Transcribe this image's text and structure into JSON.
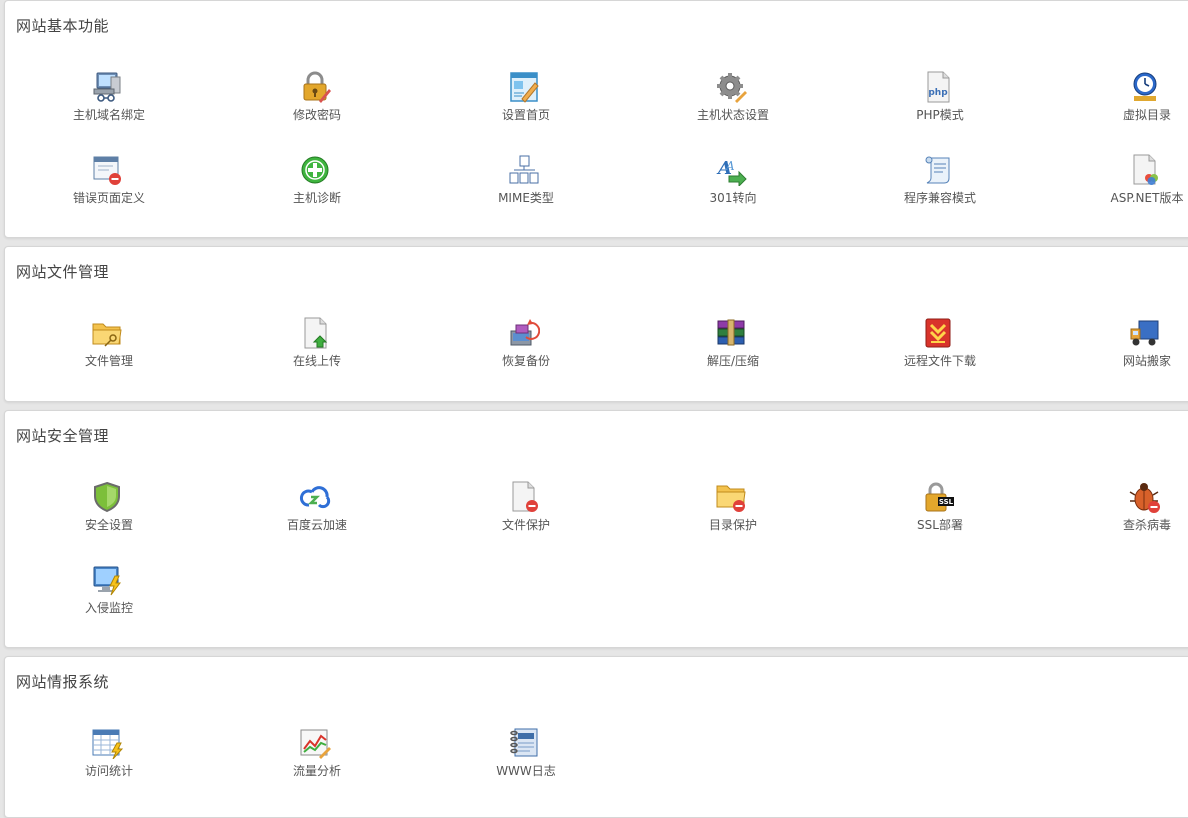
{
  "sections": [
    {
      "title": "网站基本功能",
      "items": [
        {
          "label": "主机域名绑定",
          "icon": "network-computer-icon"
        },
        {
          "label": "修改密码",
          "icon": "padlock-pen-icon"
        },
        {
          "label": "设置首页",
          "icon": "webpage-edit-icon"
        },
        {
          "label": "主机状态设置",
          "icon": "gear-icon"
        },
        {
          "label": "PHP模式",
          "icon": "php-file-icon"
        },
        {
          "label": "虚拟目录",
          "icon": "clock-folder-icon"
        },
        {
          "label": "错误页面定义",
          "icon": "error-page-icon"
        },
        {
          "label": "主机诊断",
          "icon": "green-plus-icon"
        },
        {
          "label": "MIME类型",
          "icon": "file-tree-icon"
        },
        {
          "label": "301转向",
          "icon": "redirect-arrow-icon"
        },
        {
          "label": "程序兼容模式",
          "icon": "scroll-compat-icon"
        },
        {
          "label": "ASP.NET版本",
          "icon": "aspnet-file-icon"
        }
      ]
    },
    {
      "title": "网站文件管理",
      "items": [
        {
          "label": "文件管理",
          "icon": "folder-key-icon"
        },
        {
          "label": "在线上传",
          "icon": "file-upload-icon"
        },
        {
          "label": "恢复备份",
          "icon": "restore-backup-icon"
        },
        {
          "label": "解压/压缩",
          "icon": "archive-books-icon"
        },
        {
          "label": "远程文件下载",
          "icon": "download-arrows-icon"
        },
        {
          "label": "网站搬家",
          "icon": "moving-truck-icon"
        }
      ]
    },
    {
      "title": "网站安全管理",
      "items": [
        {
          "label": "安全设置",
          "icon": "shield-icon"
        },
        {
          "label": "百度云加速",
          "icon": "cloud-accelerate-icon"
        },
        {
          "label": "文件保护",
          "icon": "file-protect-icon"
        },
        {
          "label": "目录保护",
          "icon": "folder-protect-icon"
        },
        {
          "label": "SSL部署",
          "icon": "ssl-lock-icon",
          "badge": "SSL"
        },
        {
          "label": "查杀病毒",
          "icon": "bug-icon"
        },
        {
          "label": "入侵监控",
          "icon": "monitor-lightning-icon"
        }
      ]
    },
    {
      "title": "网站情报系统",
      "items": [
        {
          "label": "访问统计",
          "icon": "stats-table-icon"
        },
        {
          "label": "流量分析",
          "icon": "traffic-chart-icon"
        },
        {
          "label": "WWW日志",
          "icon": "log-notebook-icon"
        }
      ]
    }
  ],
  "colors": {
    "panel_bg": "#ffffff",
    "page_bg": "#e6e6e6",
    "label": "#555555",
    "title": "#444444"
  }
}
